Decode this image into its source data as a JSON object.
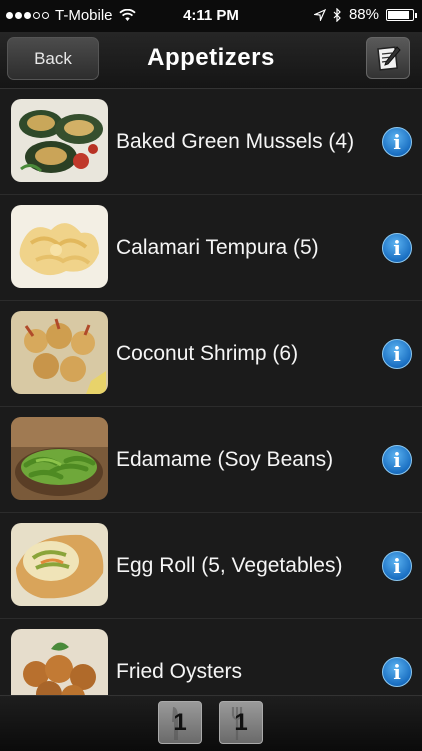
{
  "status_bar": {
    "carrier": "T-Mobile",
    "time": "4:11 PM",
    "battery": "88%",
    "battery_level": 0.88
  },
  "nav": {
    "back_label": "Back",
    "title": "Appetizers"
  },
  "items": [
    {
      "label": "Baked Green Mussels (4)"
    },
    {
      "label": "Calamari Tempura (5)"
    },
    {
      "label": "Coconut Shrimp (6)"
    },
    {
      "label": "Edamame (Soy Beans)"
    },
    {
      "label": "Egg Roll (5, Vegetables)"
    },
    {
      "label": "Fried Oysters"
    }
  ],
  "info_glyph": "i",
  "tabs": {
    "knife_count": "1",
    "fork_count": "1"
  }
}
